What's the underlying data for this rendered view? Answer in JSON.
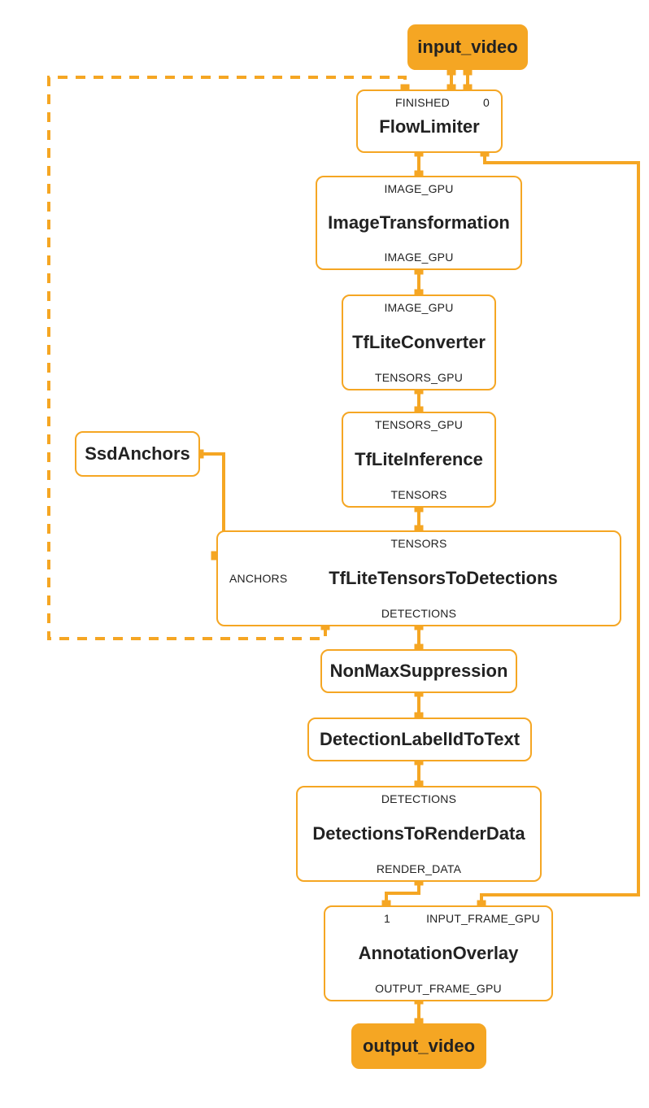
{
  "colors": {
    "accent": "#f5a623"
  },
  "nodes": {
    "input_video": {
      "label": "input_video"
    },
    "flow_limiter": {
      "label": "FlowLimiter",
      "port_in_left": "FINISHED",
      "port_in_right": "0"
    },
    "image_transformation": {
      "label": "ImageTransformation",
      "port_in": "IMAGE_GPU",
      "port_out": "IMAGE_GPU"
    },
    "tflite_converter": {
      "label": "TfLiteConverter",
      "port_in": "IMAGE_GPU",
      "port_out": "TENSORS_GPU"
    },
    "ssd_anchors": {
      "label": "SsdAnchors"
    },
    "tflite_inference": {
      "label": "TfLiteInference",
      "port_in": "TENSORS_GPU",
      "port_out": "TENSORS"
    },
    "tensors_to_detections": {
      "label": "TfLiteTensorsToDetections",
      "port_in_top": "TENSORS",
      "port_in_side": "ANCHORS",
      "port_out": "DETECTIONS"
    },
    "non_max_suppression": {
      "label": "NonMaxSuppression"
    },
    "detection_label": {
      "label": "DetectionLabelIdToText"
    },
    "detections_to_render": {
      "label": "DetectionsToRenderData",
      "port_in": "DETECTIONS",
      "port_out": "RENDER_DATA"
    },
    "annotation_overlay": {
      "label": "AnnotationOverlay",
      "port_in_left": "1",
      "port_in_right": "INPUT_FRAME_GPU",
      "port_out": "OUTPUT_FRAME_GPU"
    },
    "output_video": {
      "label": "output_video"
    }
  }
}
